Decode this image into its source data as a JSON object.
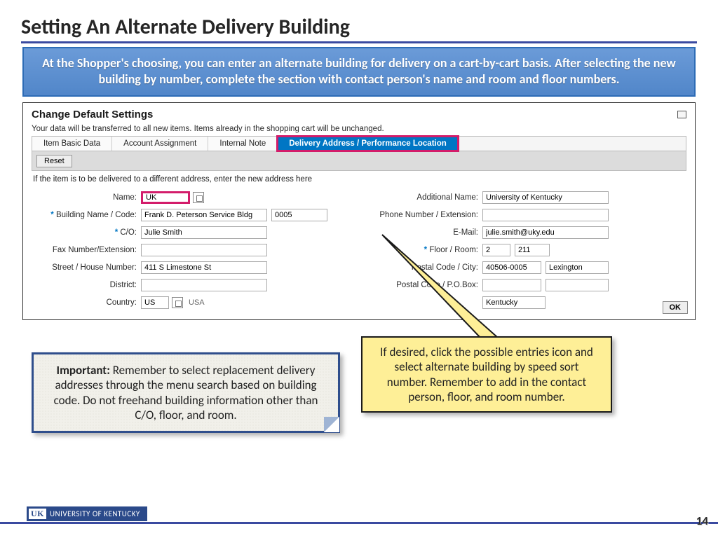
{
  "title": "Setting An Alternate Delivery Building",
  "bluebox": "At the Shopper's choosing, you can enter an alternate building for delivery on a cart-by-cart basis. After selecting the new building by number, complete the section with contact person's name and room and floor numbers.",
  "panel_title": "Change Default Settings",
  "note": "Your data will be transferred to all new items. Items already in the shopping cart will be unchanged.",
  "tabs": {
    "t1": "Item Basic Data",
    "t2": "Account Assignment",
    "t3": "Internal Note",
    "t4": "Delivery Address / Performance Location"
  },
  "reset": "Reset",
  "hint": "If the item is to be delivered to a different address, enter the new address here",
  "labels": {
    "name": "Name:",
    "bnc": "Building Name / Code:",
    "co": "C/O:",
    "fax": "Fax Number/Extension:",
    "street": "Street / House Number:",
    "district": "District:",
    "country": "Country:",
    "addname": "Additional Name:",
    "phone": "Phone Number / Extension:",
    "email": "E-Mail:",
    "floor": "Floor / Room:",
    "postal": "Postal Code / City:",
    "pobox": "Postal Code / P.O.Box:",
    "region": ""
  },
  "vals": {
    "name": "UK",
    "bname": "Frank D. Peterson Service Bldg",
    "bcode": "0005",
    "co": "Julie Smith",
    "fax": "",
    "street": "411 S Limestone St",
    "district": "",
    "country": "US",
    "countrytxt": "USA",
    "addname": "University of Kentucky",
    "phone": "",
    "email": "julie.smith@uky.edu",
    "floor": "2",
    "room": "211",
    "zip": "40506-0005",
    "city": "Lexington",
    "pobox1": "",
    "pobox2": "",
    "region": "Kentucky"
  },
  "ok": "OK",
  "important_bold": "Important: ",
  "important": "Remember to select replacement delivery addresses through the menu search based on building code. Do not freehand building information other than C/O, floor, and room.",
  "callout": "If desired, click the possible entries icon and select alternate building by speed sort number. Remember to add in the contact person, floor, and room number.",
  "uk": "UNIVERSITY OF KENTUCKY",
  "page": "14"
}
